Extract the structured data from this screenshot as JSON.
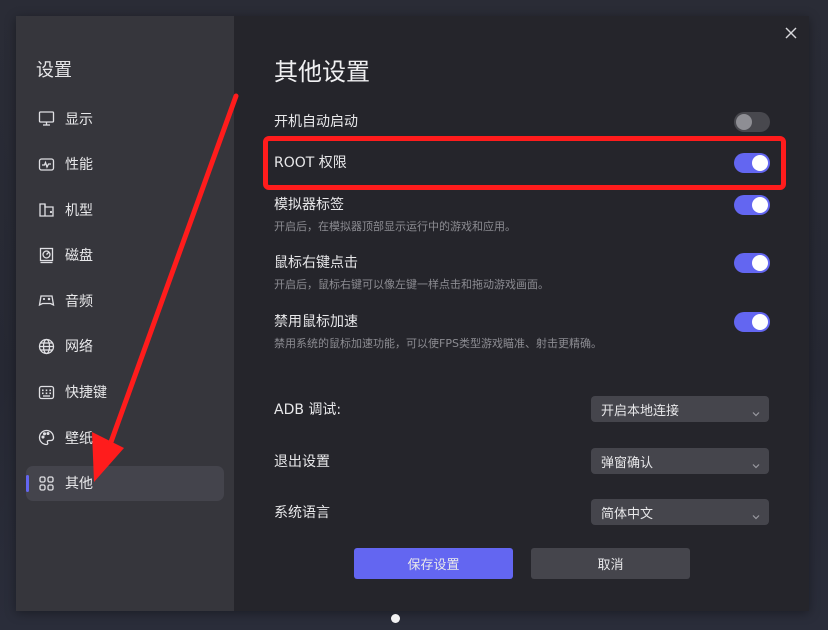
{
  "sidebar": {
    "title": "设置",
    "items": [
      {
        "label": "显示",
        "icon": "monitor-icon",
        "active": false
      },
      {
        "label": "性能",
        "icon": "performance-icon",
        "active": false
      },
      {
        "label": "机型",
        "icon": "device-model-icon",
        "active": false
      },
      {
        "label": "磁盘",
        "icon": "disk-icon",
        "active": false
      },
      {
        "label": "音频",
        "icon": "audio-icon",
        "active": false
      },
      {
        "label": "网络",
        "icon": "globe-icon",
        "active": false
      },
      {
        "label": "快捷键",
        "icon": "keyboard-icon",
        "active": false
      },
      {
        "label": "壁纸",
        "icon": "palette-icon",
        "active": false
      },
      {
        "label": "其他",
        "icon": "grid-icon",
        "active": true
      }
    ]
  },
  "main": {
    "title": "其他设置",
    "toggles": [
      {
        "label": "开机自动启动",
        "description": "",
        "on": false
      },
      {
        "label": "ROOT 权限",
        "description": "",
        "on": true
      },
      {
        "label": "模拟器标签",
        "description": "开启后，在模拟器顶部显示运行中的游戏和应用。",
        "on": true
      },
      {
        "label": "鼠标右键点击",
        "description": "开启后，鼠标右键可以像左键一样点击和拖动游戏画面。",
        "on": true
      },
      {
        "label": "禁用鼠标加速",
        "description": "禁用系统的鼠标加速功能，可以使FPS类型游戏瞄准、射击更精确。",
        "on": true
      }
    ],
    "selects": [
      {
        "label": "ADB 调试:",
        "value": "开启本地连接"
      },
      {
        "label": "退出设置",
        "value": "弹窗确认"
      },
      {
        "label": "系统语言",
        "value": "简体中文"
      }
    ],
    "buttons": {
      "save": "保存设置",
      "cancel": "取消"
    }
  },
  "annotations": {
    "highlight_color": "#ff1c1c",
    "highlighted_setting": "ROOT 权限",
    "arrow_target": "其他"
  },
  "colors": {
    "accent": "#6366f1",
    "window_bg": "#25252b",
    "sidebar_bg": "#36363c"
  }
}
